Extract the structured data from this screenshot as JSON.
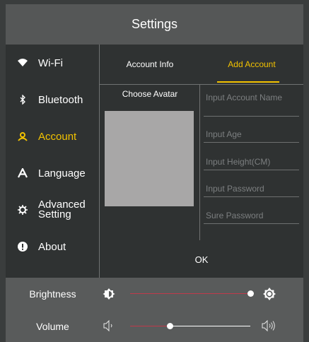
{
  "header": {
    "title": "Settings"
  },
  "sidebar": {
    "items": [
      {
        "label": "Wi-Fi",
        "icon": "wifi-icon"
      },
      {
        "label": "Bluetooth",
        "icon": "bluetooth-icon"
      },
      {
        "label": "Account",
        "icon": "user-icon",
        "active": true
      },
      {
        "label": "Language",
        "icon": "language-icon"
      },
      {
        "label": "Advanced Setting",
        "icon": "gear-icon"
      },
      {
        "label": "About",
        "icon": "info-icon"
      }
    ]
  },
  "tabs": [
    {
      "label": "Account Info"
    },
    {
      "label": "Add Account",
      "active": true
    }
  ],
  "form": {
    "avatar_label": "Choose Avatar",
    "name_placeholder": "Input Account Name",
    "age_placeholder": "Input Age",
    "height_placeholder": "Input Height(CM)",
    "password_placeholder": "Input Password",
    "confirm_placeholder": "Sure Password",
    "ok_label": "OK"
  },
  "controls": {
    "brightness_label": "Brightness",
    "brightness_level": 1.0,
    "volume_label": "Volume",
    "volume_level": 0.33
  },
  "colors": {
    "accent": "#f2c200",
    "slider_fill": "#c0394b",
    "slider_track": "#ffffff"
  }
}
